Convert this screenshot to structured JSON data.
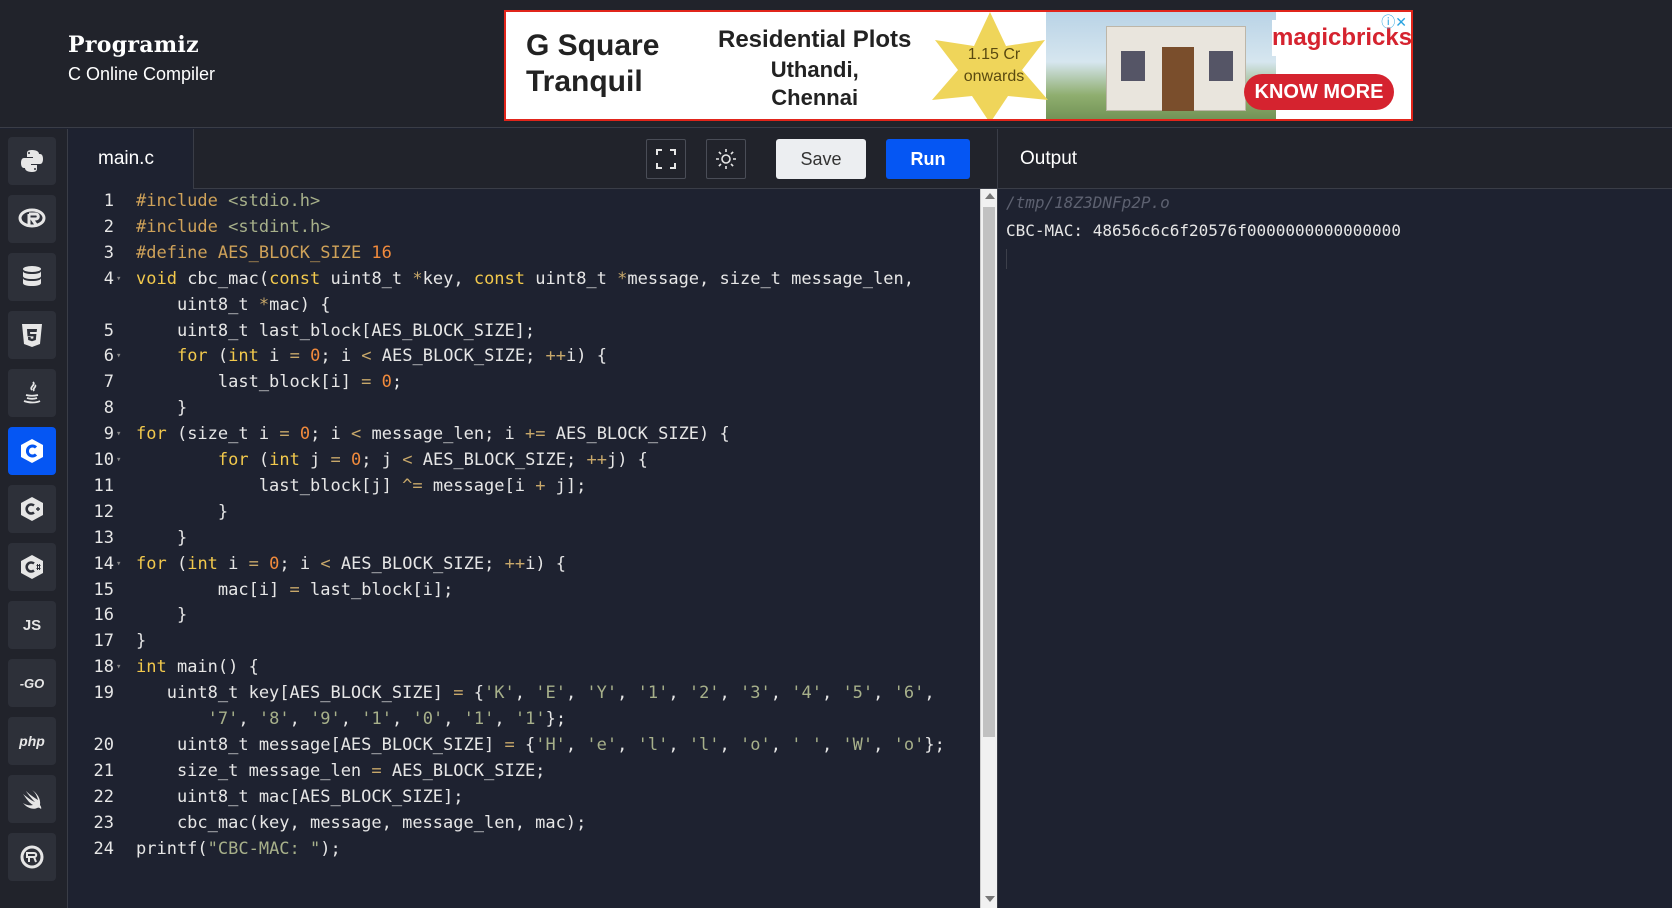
{
  "brand": {
    "logo": "Programiz",
    "subtitle": "C Online Compiler"
  },
  "ad": {
    "title_line1": "G Square",
    "title_line2": "Tranquil",
    "headline": "Residential Plots",
    "location_line1": "Uthandi,",
    "location_line2": "Chennai",
    "price_line1": "1.15 Cr",
    "price_line2": "onwards",
    "brand_name": "magicbricks",
    "cta": "KNOW MORE",
    "accent": "#d5232f"
  },
  "sidebar": {
    "items": [
      {
        "name": "python",
        "label": "",
        "icon": "python-icon",
        "active": false
      },
      {
        "name": "r",
        "label": "",
        "icon": "r-icon",
        "active": false
      },
      {
        "name": "sql",
        "label": "",
        "icon": "database-icon",
        "active": false
      },
      {
        "name": "html",
        "label": "",
        "icon": "html5-icon",
        "active": false
      },
      {
        "name": "java",
        "label": "",
        "icon": "java-icon",
        "active": false
      },
      {
        "name": "c",
        "label": "",
        "icon": "c-icon",
        "active": true
      },
      {
        "name": "cpp",
        "label": "",
        "icon": "cpp-icon",
        "active": false
      },
      {
        "name": "csharp",
        "label": "",
        "icon": "csharp-icon",
        "active": false
      },
      {
        "name": "js",
        "label": "JS",
        "icon": "js-icon",
        "active": false
      },
      {
        "name": "go",
        "label": "-GO",
        "icon": "go-icon",
        "active": false
      },
      {
        "name": "php",
        "label": "php",
        "icon": "php-icon",
        "active": false
      },
      {
        "name": "swift",
        "label": "",
        "icon": "swift-icon",
        "active": false
      },
      {
        "name": "rust",
        "label": "",
        "icon": "rust-icon",
        "active": false
      }
    ]
  },
  "editor": {
    "tab_label": "main.c",
    "save_label": "Save",
    "run_label": "Run",
    "fullscreen_icon": "fullscreen-icon",
    "theme_icon": "sun-icon"
  },
  "output": {
    "title": "Output",
    "path": "/tmp/18Z3DNFp2P.o",
    "text": "CBC-MAC: 48656c6c6f20576f0000000000000000"
  },
  "code_lines": [
    {
      "n": "1",
      "fold": false,
      "segs": [
        [
          "pp",
          "#include "
        ],
        [
          "str",
          "<stdio.h>"
        ]
      ]
    },
    {
      "n": "2",
      "fold": false,
      "segs": [
        [
          "pp",
          "#include "
        ],
        [
          "str",
          "<stdint.h>"
        ]
      ]
    },
    {
      "n": "3",
      "fold": false,
      "segs": [
        [
          "pp",
          "#define "
        ],
        [
          "pp",
          "AES_BLOCK_SIZE "
        ],
        [
          "num",
          "16"
        ]
      ]
    },
    {
      "n": "4",
      "fold": true,
      "segs": [
        [
          "kw",
          "void"
        ],
        [
          "",
          " cbc_mac("
        ],
        [
          "kw",
          "const"
        ],
        [
          "",
          " uint8_t "
        ],
        [
          "op",
          "*"
        ],
        [
          "",
          "key, "
        ],
        [
          "kw",
          "const"
        ],
        [
          "",
          " uint8_t "
        ],
        [
          "op",
          "*"
        ],
        [
          "",
          "message, size_t message_len,"
        ]
      ]
    },
    {
      "n": "",
      "fold": false,
      "segs": [
        [
          "",
          "    uint8_t "
        ],
        [
          "op",
          "*"
        ],
        [
          "",
          "mac) {"
        ]
      ]
    },
    {
      "n": "5",
      "fold": false,
      "segs": [
        [
          "",
          "    uint8_t last_block[AES_BLOCK_SIZE];"
        ]
      ]
    },
    {
      "n": "6",
      "fold": true,
      "segs": [
        [
          "",
          "    "
        ],
        [
          "kw",
          "for"
        ],
        [
          "",
          " ("
        ],
        [
          "kw",
          "int"
        ],
        [
          "",
          " i "
        ],
        [
          "op",
          "="
        ],
        [
          "",
          " "
        ],
        [
          "num",
          "0"
        ],
        [
          "",
          "; i "
        ],
        [
          "op",
          "<"
        ],
        [
          "",
          " AES_BLOCK_SIZE; "
        ],
        [
          "op",
          "++"
        ],
        [
          "",
          "i) {"
        ]
      ]
    },
    {
      "n": "7",
      "fold": false,
      "segs": [
        [
          "",
          "        last_block[i] "
        ],
        [
          "op",
          "="
        ],
        [
          "",
          " "
        ],
        [
          "num",
          "0"
        ],
        [
          "",
          ";"
        ]
      ]
    },
    {
      "n": "8",
      "fold": false,
      "segs": [
        [
          "",
          "    }"
        ]
      ]
    },
    {
      "n": "9",
      "fold": true,
      "segs": [
        [
          "kw",
          "for"
        ],
        [
          "",
          " (size_t i "
        ],
        [
          "op",
          "="
        ],
        [
          "",
          " "
        ],
        [
          "num",
          "0"
        ],
        [
          "",
          "; i "
        ],
        [
          "op",
          "<"
        ],
        [
          "",
          " message_len; i "
        ],
        [
          "op",
          "+="
        ],
        [
          "",
          " AES_BLOCK_SIZE) {"
        ]
      ]
    },
    {
      "n": "10",
      "fold": true,
      "segs": [
        [
          "",
          "        "
        ],
        [
          "kw",
          "for"
        ],
        [
          "",
          " ("
        ],
        [
          "kw",
          "int"
        ],
        [
          "",
          " j "
        ],
        [
          "op",
          "="
        ],
        [
          "",
          " "
        ],
        [
          "num",
          "0"
        ],
        [
          "",
          "; j "
        ],
        [
          "op",
          "<"
        ],
        [
          "",
          " AES_BLOCK_SIZE; "
        ],
        [
          "op",
          "++"
        ],
        [
          "",
          "j) {"
        ]
      ]
    },
    {
      "n": "11",
      "fold": false,
      "segs": [
        [
          "",
          "            last_block[j] "
        ],
        [
          "op",
          "^="
        ],
        [
          "",
          " message[i "
        ],
        [
          "op",
          "+"
        ],
        [
          "",
          " j];"
        ]
      ]
    },
    {
      "n": "12",
      "fold": false,
      "segs": [
        [
          "",
          "        }"
        ]
      ]
    },
    {
      "n": "13",
      "fold": false,
      "segs": [
        [
          "",
          "    }"
        ]
      ]
    },
    {
      "n": "14",
      "fold": true,
      "segs": [
        [
          "kw",
          "for"
        ],
        [
          "",
          " ("
        ],
        [
          "kw",
          "int"
        ],
        [
          "",
          " i "
        ],
        [
          "op",
          "="
        ],
        [
          "",
          " "
        ],
        [
          "num",
          "0"
        ],
        [
          "",
          "; i "
        ],
        [
          "op",
          "<"
        ],
        [
          "",
          " AES_BLOCK_SIZE; "
        ],
        [
          "op",
          "++"
        ],
        [
          "",
          "i) {"
        ]
      ]
    },
    {
      "n": "15",
      "fold": false,
      "segs": [
        [
          "",
          "        mac[i] "
        ],
        [
          "op",
          "="
        ],
        [
          "",
          " last_block[i];"
        ]
      ]
    },
    {
      "n": "16",
      "fold": false,
      "segs": [
        [
          "",
          "    }"
        ]
      ]
    },
    {
      "n": "17",
      "fold": false,
      "segs": [
        [
          "",
          "}"
        ]
      ]
    },
    {
      "n": "18",
      "fold": true,
      "segs": [
        [
          "kw",
          "int"
        ],
        [
          "",
          " main() {"
        ]
      ]
    },
    {
      "n": "19",
      "fold": false,
      "segs": [
        [
          "",
          "   uint8_t key[AES_BLOCK_SIZE] "
        ],
        [
          "op",
          "="
        ],
        [
          "",
          " {"
        ],
        [
          "str",
          "'K'"
        ],
        [
          "",
          ", "
        ],
        [
          "str",
          "'E'"
        ],
        [
          "",
          ", "
        ],
        [
          "str",
          "'Y'"
        ],
        [
          "",
          ", "
        ],
        [
          "str",
          "'1'"
        ],
        [
          "",
          ", "
        ],
        [
          "str",
          "'2'"
        ],
        [
          "",
          ", "
        ],
        [
          "str",
          "'3'"
        ],
        [
          "",
          ", "
        ],
        [
          "str",
          "'4'"
        ],
        [
          "",
          ", "
        ],
        [
          "str",
          "'5'"
        ],
        [
          "",
          ", "
        ],
        [
          "str",
          "'6'"
        ],
        [
          "",
          ","
        ]
      ]
    },
    {
      "n": "",
      "fold": false,
      "segs": [
        [
          "",
          "       "
        ],
        [
          "str",
          "'7'"
        ],
        [
          "",
          ", "
        ],
        [
          "str",
          "'8'"
        ],
        [
          "",
          ", "
        ],
        [
          "str",
          "'9'"
        ],
        [
          "",
          ", "
        ],
        [
          "str",
          "'1'"
        ],
        [
          "",
          ", "
        ],
        [
          "str",
          "'0'"
        ],
        [
          "",
          ", "
        ],
        [
          "str",
          "'1'"
        ],
        [
          "",
          ", "
        ],
        [
          "str",
          "'1'"
        ],
        [
          "",
          "};"
        ]
      ]
    },
    {
      "n": "20",
      "fold": false,
      "segs": [
        [
          "",
          "    uint8_t message[AES_BLOCK_SIZE] "
        ],
        [
          "op",
          "="
        ],
        [
          "",
          " {"
        ],
        [
          "str",
          "'H'"
        ],
        [
          "",
          ", "
        ],
        [
          "str",
          "'e'"
        ],
        [
          "",
          ", "
        ],
        [
          "str",
          "'l'"
        ],
        [
          "",
          ", "
        ],
        [
          "str",
          "'l'"
        ],
        [
          "",
          ", "
        ],
        [
          "str",
          "'o'"
        ],
        [
          "",
          ", "
        ],
        [
          "str",
          "' '"
        ],
        [
          "",
          ", "
        ],
        [
          "str",
          "'W'"
        ],
        [
          "",
          ", "
        ],
        [
          "str",
          "'o'"
        ],
        [
          "",
          "};"
        ]
      ]
    },
    {
      "n": "21",
      "fold": false,
      "segs": [
        [
          "",
          "    size_t message_len "
        ],
        [
          "op",
          "="
        ],
        [
          "",
          " AES_BLOCK_SIZE;"
        ]
      ]
    },
    {
      "n": "22",
      "fold": false,
      "segs": [
        [
          "",
          "    uint8_t mac[AES_BLOCK_SIZE];"
        ]
      ]
    },
    {
      "n": "23",
      "fold": false,
      "segs": [
        [
          "",
          "    cbc_mac(key, message, message_len, mac);"
        ]
      ]
    },
    {
      "n": "24",
      "fold": false,
      "segs": [
        [
          "",
          "printf("
        ],
        [
          "str",
          "\"CBC-MAC: \""
        ],
        [
          "",
          ");"
        ]
      ]
    }
  ]
}
